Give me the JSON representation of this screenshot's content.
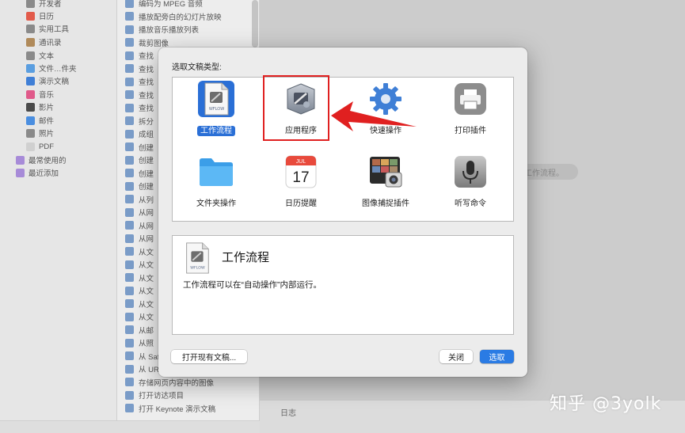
{
  "library": {
    "items": [
      {
        "label": "开发者",
        "color": "#8a8a8a"
      },
      {
        "label": "日历",
        "color": "#e25b4b"
      },
      {
        "label": "实用工具",
        "color": "#8a8a8a"
      },
      {
        "label": "通讯录",
        "color": "#b08a5a"
      },
      {
        "label": "文本",
        "color": "#8a8a8a"
      },
      {
        "label": "文件…件夹",
        "color": "#5a9ee0"
      },
      {
        "label": "演示文稿",
        "color": "#3f7fd6"
      },
      {
        "label": "音乐",
        "color": "#e05a8a"
      },
      {
        "label": "影片",
        "color": "#4a4a4a"
      },
      {
        "label": "邮件",
        "color": "#4a8ee0"
      },
      {
        "label": "照片",
        "color": "#8a8a8a"
      },
      {
        "label": "PDF",
        "color": "#d0d0d0"
      },
      {
        "label": "最常使用的",
        "color": "#a78bd8"
      },
      {
        "label": "最近添加",
        "color": "#a78bd8"
      }
    ]
  },
  "actions": {
    "items": [
      {
        "label": "编码为 MPEG 音频"
      },
      {
        "label": "播放配旁白的幻灯片放映"
      },
      {
        "label": "播放音乐播放列表"
      },
      {
        "label": "裁剪图像"
      },
      {
        "label": "查找"
      },
      {
        "label": "查找"
      },
      {
        "label": "查找"
      },
      {
        "label": "查找"
      },
      {
        "label": "查找"
      },
      {
        "label": "拆分"
      },
      {
        "label": "成组"
      },
      {
        "label": "创建"
      },
      {
        "label": "创建"
      },
      {
        "label": "创建"
      },
      {
        "label": "创建"
      },
      {
        "label": "从列"
      },
      {
        "label": "从网"
      },
      {
        "label": "从网"
      },
      {
        "label": "从网"
      },
      {
        "label": "从文"
      },
      {
        "label": "从文"
      },
      {
        "label": "从文"
      },
      {
        "label": "从文"
      },
      {
        "label": "从文"
      },
      {
        "label": "从文"
      },
      {
        "label": "从邮"
      },
      {
        "label": "从照"
      },
      {
        "label": "从 Saf"
      },
      {
        "label": "从 UR"
      },
      {
        "label": "存储网页内容中的图像"
      },
      {
        "label": "打开访达项目"
      },
      {
        "label": "打开 Keynote 演示文稿"
      }
    ]
  },
  "workspace": {
    "hint": "工作流程。",
    "log_label": "日志",
    "watermark": "知乎 @3yolk"
  },
  "dialog": {
    "title": "选取文稿类型:",
    "types": [
      {
        "label": "工作流程",
        "icon": "workflow-icon",
        "selected": true
      },
      {
        "label": "应用程序",
        "icon": "application-icon",
        "selected": false
      },
      {
        "label": "快速操作",
        "icon": "gear-icon",
        "selected": false
      },
      {
        "label": "打印插件",
        "icon": "printer-icon",
        "selected": false
      },
      {
        "label": "文件夹操作",
        "icon": "folder-icon",
        "selected": false
      },
      {
        "label": "日历提醒",
        "icon": "calendar-icon",
        "selected": false
      },
      {
        "label": "图像捕捉插件",
        "icon": "image-capture-icon",
        "selected": false
      },
      {
        "label": "听写命令",
        "icon": "microphone-icon",
        "selected": false
      }
    ],
    "calendar_month": "JUL",
    "calendar_day": "17",
    "workflow_badge": "WFLOW",
    "description": {
      "title": "工作流程",
      "text": "工作流程可以在“自动操作”内部运行。"
    },
    "buttons": {
      "open_existing": "打开现有文稿...",
      "close": "关闭",
      "choose": "选取"
    },
    "colors": {
      "selection": "#2a6fd6",
      "annotation": "#e02020",
      "primary_button": "#2a7be4"
    }
  }
}
